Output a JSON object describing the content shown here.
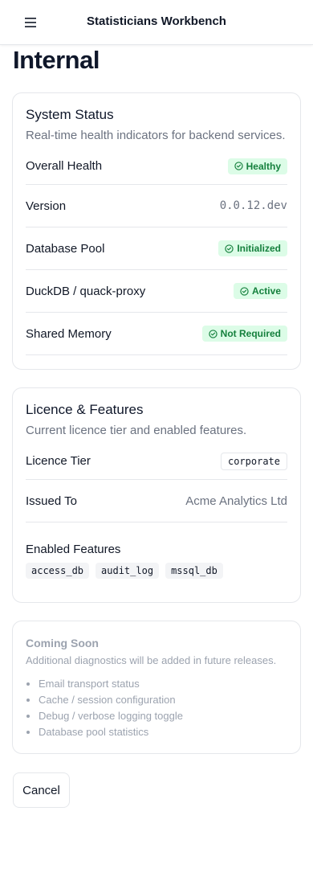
{
  "header": {
    "title": "Statisticians Workbench",
    "menu_icon": "hamburger-menu-icon"
  },
  "page": {
    "title": "Internal"
  },
  "system_status": {
    "title": "System Status",
    "subtitle": "Real-time health indicators for backend services.",
    "rows": [
      {
        "label": "Overall Health",
        "value": "Healthy",
        "kind": "badge"
      },
      {
        "label": "Version",
        "value": "0.0.12.dev",
        "kind": "mono"
      },
      {
        "label": "Database Pool",
        "value": "Initialized",
        "kind": "badge"
      },
      {
        "label": "DuckDB / quack-proxy",
        "value": "Active",
        "kind": "badge"
      },
      {
        "label": "Shared Memory",
        "value": "Not Required",
        "kind": "badge"
      }
    ],
    "badge_icon": "check-circle-icon",
    "colors": {
      "badge_bg": "#dcfce7",
      "badge_text": "#15803d"
    }
  },
  "licence": {
    "title": "Licence & Features",
    "subtitle": "Current licence tier and enabled features.",
    "tier_label": "Licence Tier",
    "tier_value": "corporate",
    "issued_label": "Issued To",
    "issued_value": "Acme Analytics Ltd",
    "features_label": "Enabled Features",
    "features": [
      "access_db",
      "audit_log",
      "mssql_db"
    ]
  },
  "coming_soon": {
    "title": "Coming Soon",
    "subtitle": "Additional diagnostics will be added in future releases.",
    "items": [
      "Email transport status",
      "Cache / session configuration",
      "Debug / verbose logging toggle",
      "Database pool statistics"
    ]
  },
  "actions": {
    "cancel_label": "Cancel"
  }
}
